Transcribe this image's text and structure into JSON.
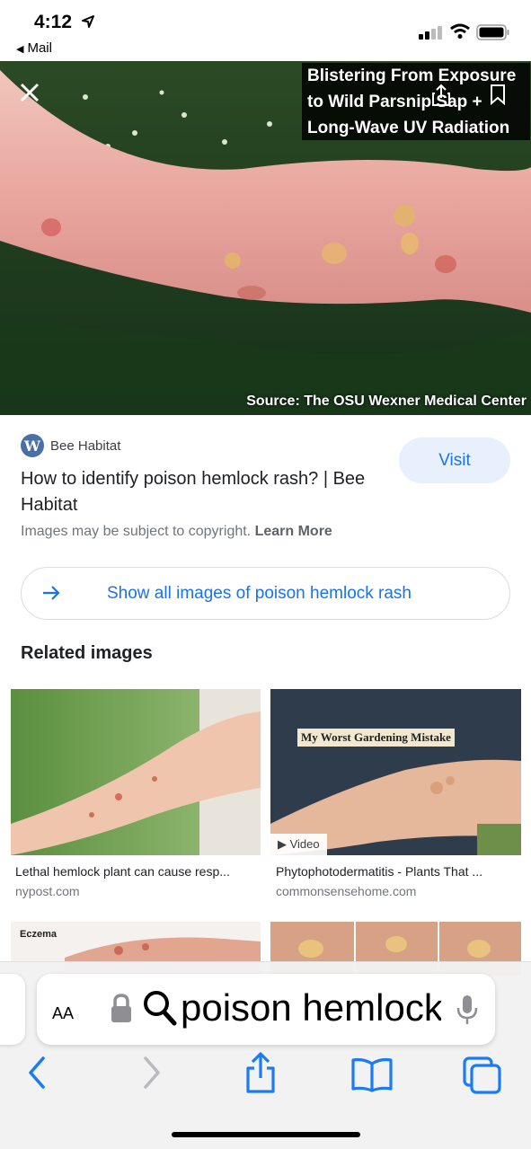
{
  "status_bar": {
    "time": "4:12",
    "back_app": "Mail"
  },
  "hero": {
    "caption": "Blistering From Exposure\nto Wild Parsnip Sap +\nLong-Wave UV Radiation",
    "source": "Source:  The OSU Wexner Medical Center"
  },
  "result": {
    "site_name": "Bee Habitat",
    "visit_label": "Visit",
    "title": "How to identify poison hemlock rash? | Bee Habitat",
    "copyright_text": "Images may be subject to copyright.",
    "learn_more": "Learn More",
    "show_all": "Show all images of poison hemlock rash"
  },
  "related": {
    "heading": "Related images",
    "items": [
      {
        "title": "Lethal hemlock plant can cause resp...",
        "source": "nypost.com"
      },
      {
        "title": "Phytophotodermatitis - Plants That ...",
        "source": "commonsensehome.com",
        "image_text": "My Worst Gardening Mistake",
        "badge": "Video"
      },
      {
        "image_text": "Eczema"
      }
    ]
  },
  "browser": {
    "aa_label": "AA",
    "address": "poison hemlock rash"
  },
  "colors": {
    "accent": "#1a73e8",
    "visit_bg": "#e8f0fe"
  }
}
